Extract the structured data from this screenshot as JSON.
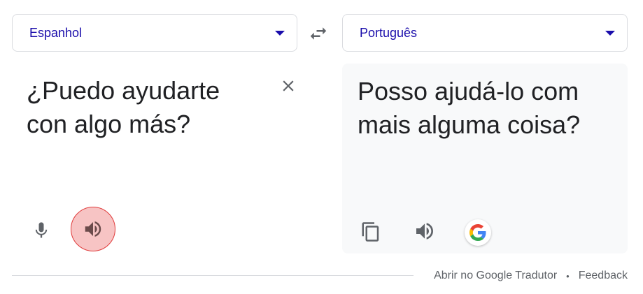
{
  "source": {
    "language": "Espanhol",
    "text": "¿Puedo ayudarte con algo más?"
  },
  "target": {
    "language": "Português",
    "text": "Posso ajudá-lo com mais alguma coisa?"
  },
  "footer": {
    "open_link": "Abrir no Google Tradutor",
    "separator": "•",
    "feedback": "Feedback"
  },
  "colors": {
    "link": "#1a0dab",
    "active_speaker_bg": "#f7c4c4",
    "active_speaker_border": "#e03a3a"
  },
  "icons": [
    "swap-icon",
    "close-icon",
    "mic-icon",
    "speaker-icon",
    "copy-icon",
    "google-g-icon",
    "chevron-down-icon"
  ]
}
